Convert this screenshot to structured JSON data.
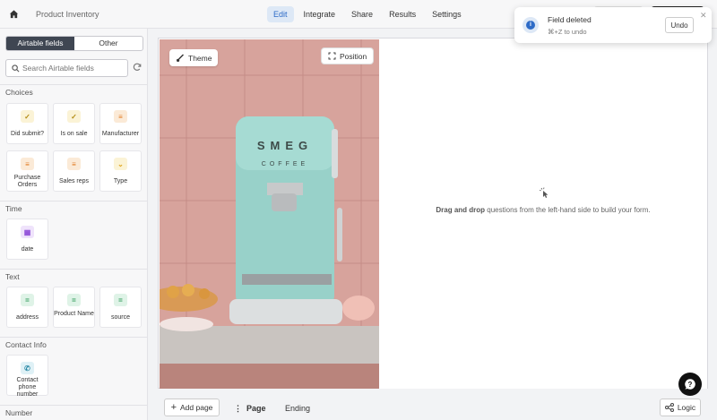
{
  "topbar": {
    "title": "Product Inventory",
    "tabs": [
      {
        "label": "Edit",
        "active": true
      },
      {
        "label": "Integrate",
        "active": false
      },
      {
        "label": "Share",
        "active": false
      },
      {
        "label": "Results",
        "active": false
      },
      {
        "label": "Settings",
        "active": false
      }
    ]
  },
  "sidebar": {
    "segment": {
      "left": "Airtable fields",
      "right": "Other"
    },
    "search": {
      "placeholder": "Search Airtable fields"
    },
    "sections": {
      "choices": {
        "title": "Choices",
        "cards": [
          {
            "label": "Did submit?",
            "icon": "checkbox-icon"
          },
          {
            "label": "Is on sale",
            "icon": "checkbox-icon"
          },
          {
            "label": "Manufacturer",
            "icon": "list-icon"
          },
          {
            "label": "Purchase Orders",
            "icon": "list-icon"
          },
          {
            "label": "Sales reps",
            "icon": "list-icon"
          },
          {
            "label": "Type",
            "icon": "caret-icon"
          }
        ]
      },
      "time": {
        "title": "Time",
        "cards": [
          {
            "label": "date",
            "icon": "calendar-icon"
          }
        ]
      },
      "text": {
        "title": "Text",
        "cards": [
          {
            "label": "address",
            "icon": "text-icon"
          },
          {
            "label": "Product Name",
            "icon": "text-icon"
          },
          {
            "label": "source",
            "icon": "text-icon"
          }
        ]
      },
      "contact": {
        "title": "Contact Info",
        "cards": [
          {
            "label": "Contact phone number",
            "icon": "phone-icon"
          }
        ]
      },
      "number": {
        "title": "Number"
      }
    }
  },
  "main": {
    "theme_label": "Theme",
    "position_label": "Position",
    "drag_bold": "Drag and drop",
    "drag_rest": " questions from the left-hand side to build your form."
  },
  "bottom": {
    "add_page": "Add page",
    "page_tab": "Page",
    "ending_tab": "Ending",
    "logic": "Logic"
  },
  "toast": {
    "title": "Field deleted",
    "subtitle": "⌘+Z to undo",
    "undo": "Undo"
  },
  "colors": {
    "accent": "#2d6bc7",
    "segment_active": "#3f4652"
  }
}
